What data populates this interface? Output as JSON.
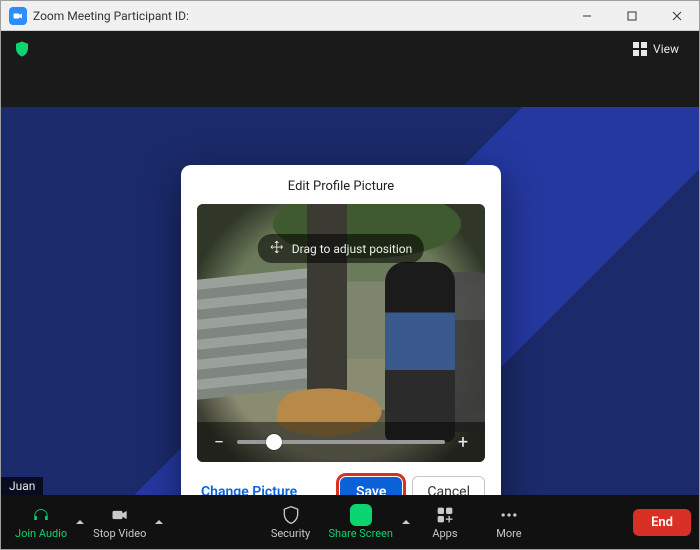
{
  "titlebar": {
    "title": "Zoom Meeting Participant ID:"
  },
  "meeting_top": {
    "view_label": "View"
  },
  "participant_name": "Juan",
  "modal": {
    "title": "Edit Profile Picture",
    "drag_hint": "Drag to adjust position",
    "zoom": {
      "minus": "−",
      "plus": "+",
      "value_pct": 18
    },
    "change_label": "Change Picture",
    "save_label": "Save",
    "cancel_label": "Cancel"
  },
  "toolbar": {
    "join_audio": "Join Audio",
    "stop_video": "Stop Video",
    "security": "Security",
    "share_screen": "Share Screen",
    "apps": "Apps",
    "more": "More",
    "end": "End"
  }
}
